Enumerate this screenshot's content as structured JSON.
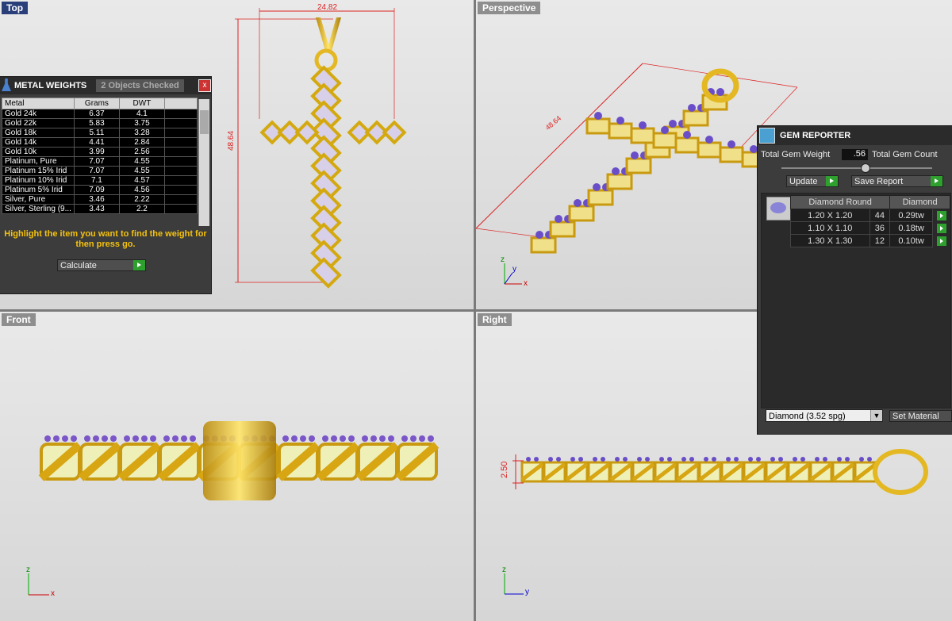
{
  "viewports": {
    "top": "Top",
    "perspective": "Perspective",
    "front": "Front",
    "right": "Right"
  },
  "dimensions": {
    "width": "24.82",
    "height": "48.64",
    "perspective": "48.64",
    "thickness": "2.50"
  },
  "axes": {
    "x": "x",
    "y": "y",
    "z": "z"
  },
  "metal_weights": {
    "title": "METAL WEIGHTS",
    "tab": "2 Objects Checked",
    "close": "x",
    "columns": [
      "Metal",
      "Grams",
      "DWT"
    ],
    "rows": [
      [
        "Gold 24k",
        "6.37",
        "4.1"
      ],
      [
        "Gold 22k",
        "5.83",
        "3.75"
      ],
      [
        "Gold 18k",
        "5.11",
        "3.28"
      ],
      [
        "Gold 14k",
        "4.41",
        "2.84"
      ],
      [
        "Gold 10k",
        "3.99",
        "2.56"
      ],
      [
        "Platinum, Pure",
        "7.07",
        "4.55"
      ],
      [
        "Platinum 15% Irid",
        "7.07",
        "4.55"
      ],
      [
        "Platinum 10% Irid",
        "7.1",
        "4.57"
      ],
      [
        "Platinum 5% Irid",
        "7.09",
        "4.56"
      ],
      [
        "Silver, Pure",
        "3.46",
        "2.22"
      ],
      [
        "Silver, Sterling (9...",
        "3.43",
        "2.2"
      ]
    ],
    "hint": "Highlight the item you want to find the weight for then press go.",
    "calculate": "Calculate"
  },
  "gem_reporter": {
    "title": "GEM REPORTER",
    "total_weight_label": "Total Gem Weight",
    "total_weight_value": ".56",
    "total_count_label": "Total Gem Count",
    "update": "Update",
    "save_report": "Save Report",
    "col_shape": "Diamond Round",
    "col_material": "Diamond",
    "rows": [
      [
        "1.20 X 1.20",
        "44",
        "0.29tw"
      ],
      [
        "1.10 X 1.10",
        "36",
        "0.18tw"
      ],
      [
        "1.30 X 1.30",
        "12",
        "0.10tw"
      ]
    ],
    "material_select": "Diamond    (3.52 spg)",
    "set_material": "Set Material"
  }
}
